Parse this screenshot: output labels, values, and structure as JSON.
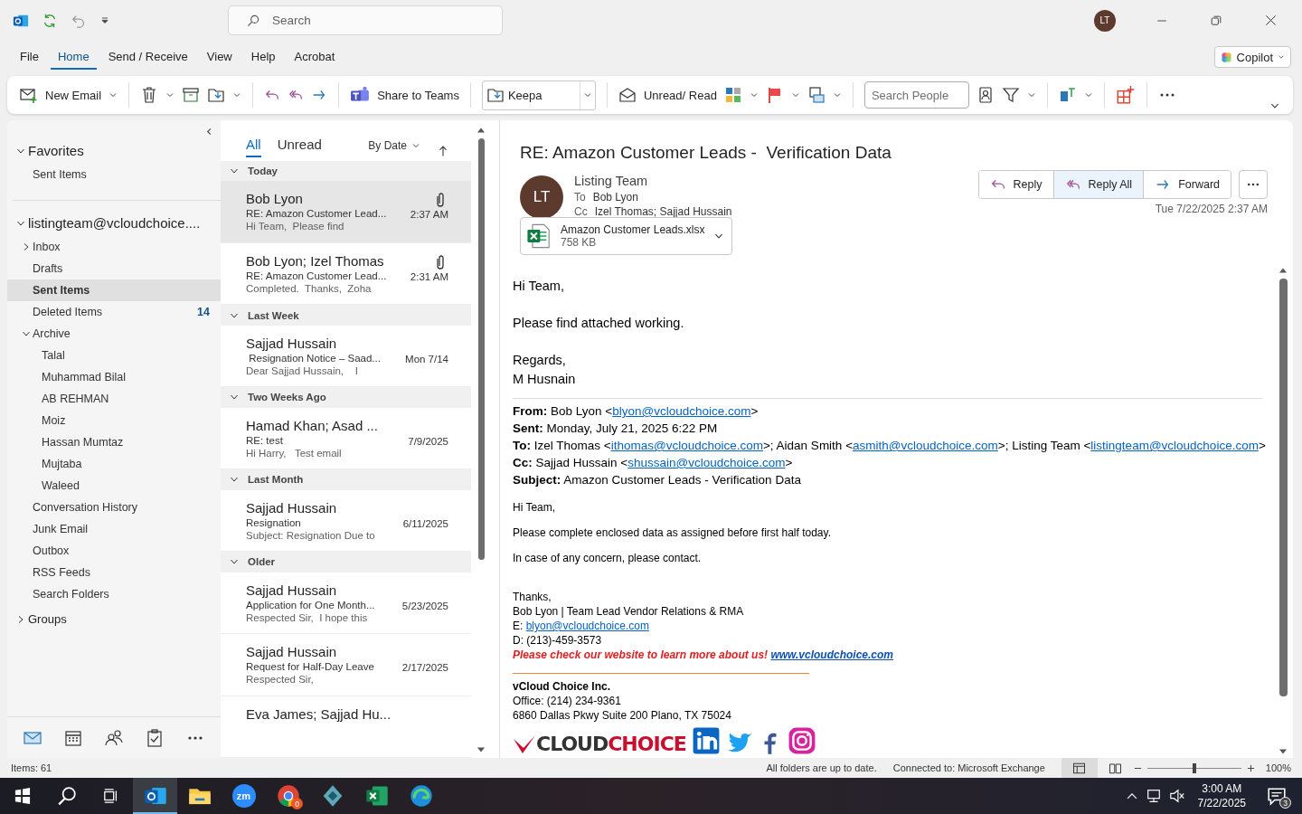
{
  "title_bar": {
    "search": {
      "placeholder": "Search"
    },
    "avatar": "LT"
  },
  "menu": [
    {
      "label": "File",
      "selected": false
    },
    {
      "label": "Home",
      "selected": true
    },
    {
      "label": "Send / Receive",
      "selected": false
    },
    {
      "label": "View",
      "selected": false
    },
    {
      "label": "Help",
      "selected": false
    },
    {
      "label": "Acrobat",
      "selected": false
    }
  ],
  "copilot": "Copilot",
  "ribbon": {
    "new_email": "New Email",
    "share_to_teams": "Share to Teams",
    "move_to": "Keepa",
    "unread_read": "Unread/ Read",
    "search_people": {
      "placeholder": "Search People"
    }
  },
  "folders": [
    {
      "label": "Favorites",
      "kind": "section",
      "expanded": true,
      "children": [
        {
          "label": "Sent Items",
          "selected": false
        }
      ]
    },
    {
      "label": "listingteam@vcloudchoice....",
      "kind": "section",
      "expanded": true,
      "children": [
        {
          "label": "Inbox",
          "selected": false,
          "expanded": false
        },
        {
          "label": "Drafts",
          "selected": false
        },
        {
          "label": "Sent Items",
          "selected": true
        },
        {
          "label": "Deleted Items",
          "selected": false,
          "count": "14"
        },
        {
          "label": "Archive",
          "selected": false,
          "expanded": true,
          "children": [
            {
              "label": "Talal",
              "selected": false
            },
            {
              "label": "Muhammad Bilal",
              "selected": false
            },
            {
              "label": "AB REHMAN",
              "selected": false
            },
            {
              "label": "Moiz",
              "selected": false
            },
            {
              "label": "Hassan Mumtaz",
              "selected": false
            },
            {
              "label": "Mujtaba",
              "selected": false
            },
            {
              "label": "Waleed",
              "selected": false
            }
          ]
        },
        {
          "label": "Conversation History",
          "selected": false
        },
        {
          "label": "Junk Email",
          "selected": false
        },
        {
          "label": "Outbox",
          "selected": false
        },
        {
          "label": "RSS Feeds",
          "selected": false
        },
        {
          "label": "Search Folders",
          "selected": false
        }
      ]
    },
    {
      "label": "Groups",
      "kind": "group",
      "expanded": false
    }
  ],
  "message_list": {
    "tabs": [
      {
        "label": "All",
        "selected": true
      },
      {
        "label": "Unread",
        "selected": false
      }
    ],
    "sort": "By Date",
    "groups": [
      {
        "label": "Today",
        "expanded": true,
        "messages": [
          {
            "sender": "Bob Lyon",
            "subject": "RE: Amazon Customer Lead...",
            "preview": "Hi Team,  Please find",
            "time": "2:37 AM",
            "attachment": true,
            "selected": true
          },
          {
            "sender": "Bob Lyon; Izel Thomas",
            "subject": "RE: Amazon Customer Lead...",
            "preview": "Completed.  Thanks,  Zoha",
            "time": "2:31 AM",
            "attachment": true,
            "selected": false
          }
        ]
      },
      {
        "label": "Last Week",
        "expanded": true,
        "messages": [
          {
            "sender": "Sajjad Hussain",
            "subject": " Resignation Notice – Saad...",
            "preview": "Dear Sajjad Hussain,    I",
            "time": "Mon 7/14",
            "attachment": false,
            "selected": false
          }
        ]
      },
      {
        "label": "Two Weeks Ago",
        "expanded": true,
        "messages": [
          {
            "sender": "Hamad Khan; Asad ...",
            "subject": "RE: test",
            "preview": "Hi Harry,   Test email",
            "time": "7/9/2025",
            "attachment": false,
            "selected": false
          }
        ]
      },
      {
        "label": "Last Month",
        "expanded": true,
        "messages": [
          {
            "sender": "Sajjad Hussain",
            "subject": "Resignation",
            "preview": "Subject: Resignation Due to",
            "time": "6/11/2025",
            "attachment": false,
            "selected": false
          }
        ]
      },
      {
        "label": "Older",
        "expanded": true,
        "messages": [
          {
            "sender": "Sajjad Hussain",
            "subject": "Application for One Month...",
            "preview": "Respected Sir,  I hope this",
            "time": "5/23/2025",
            "attachment": false,
            "selected": false
          },
          {
            "sender": "Sajjad Hussain",
            "subject": "Request for Half-Day Leave",
            "preview": "Respected Sir,",
            "time": "2/17/2025",
            "attachment": false,
            "selected": false
          },
          {
            "sender": "Eva James; Sajjad Hu...",
            "attachment": false,
            "selected": false
          }
        ]
      }
    ]
  },
  "reading_pane": {
    "subject": "RE: Amazon Customer Leads -  Verification Data",
    "sender": {
      "initials": "LT",
      "name": "Listing Team",
      "to_label": "To",
      "to": "Bob Lyon",
      "cc_label": "Cc",
      "cc": "Izel Thomas; Sajjad Hussain"
    },
    "actions": [
      {
        "kind": "reply",
        "label": "Reply",
        "selected": false
      },
      {
        "kind": "reply_all",
        "label": "Reply All",
        "selected": true
      },
      {
        "kind": "forward",
        "label": "Forward",
        "selected": false
      }
    ],
    "date": "Tue 7/22/2025 2:37 AM",
    "attachment": {
      "name": "Amazon Customer Leads.xlsx",
      "size": "758 KB"
    },
    "body": [
      [
        "Hi Team,"
      ],
      [
        "Please find attached working."
      ],
      [
        "Regards,",
        "M Husnain"
      ]
    ],
    "quoted_header": [
      {
        "label": "From:",
        "parts": [
          {
            "kind": "text",
            "text": " Bob Lyon <"
          },
          {
            "kind": "link",
            "text": "blyon@vcloudchoice.com"
          },
          {
            "kind": "text",
            "text": ">"
          }
        ]
      },
      {
        "label": "Sent:",
        "parts": [
          {
            "kind": "text",
            "text": " Monday, July 21, 2025 6:22 PM"
          }
        ]
      },
      {
        "label": "To:",
        "parts": [
          {
            "kind": "text",
            "text": " Izel Thomas <"
          },
          {
            "kind": "link",
            "text": "ithomas@vcloudchoice.com"
          },
          {
            "kind": "text",
            "text": ">; Aidan Smith <"
          },
          {
            "kind": "link",
            "text": "asmith@vcloudchoice.com"
          },
          {
            "kind": "text",
            "text": ">; Listing Team <"
          },
          {
            "kind": "link",
            "text": "listingteam@vcloudchoice.com"
          },
          {
            "kind": "text",
            "text": ">"
          }
        ]
      },
      {
        "label": "Cc:",
        "parts": [
          {
            "kind": "text",
            "text": " Sajjad Hussain <"
          },
          {
            "kind": "link",
            "text": "shussain@vcloudchoice.com"
          },
          {
            "kind": "text",
            "text": ">"
          }
        ]
      },
      {
        "label": "Subject:",
        "parts": [
          {
            "kind": "text",
            "text": " Amazon Customer Leads - Verification Data"
          }
        ]
      }
    ],
    "quoted_body": [
      "Hi Team,",
      "Please complete enclosed data as assigned before first half today.",
      "In case of any concern, please contact."
    ],
    "signature": {
      "closing": "Thanks,",
      "title": "Bob Lyon | Team Lead Vendor Relations & RMA",
      "email_label": "E: ",
      "email": "blyon@vcloudchoice.com",
      "direct": "D: (213)-459-3573",
      "promo": "Please check our website to learn more about us! ",
      "website": "www.vcloudchoice.com",
      "company": "vCloud Choice Inc.",
      "office": "Office: (214) 234-9361",
      "address": "6860 Dallas Pkwy Suite 200 Plano, TX 75024",
      "logo": {
        "dark": "CLOUD",
        "red": "CHOICE"
      }
    }
  },
  "status_bar": {
    "items": "Items: 61",
    "sync": "All folders are up to date.",
    "connection": "Connected to: Microsoft Exchange",
    "zoom": "100%",
    "zoom_level": {
      "level": 0.5
    }
  },
  "taskbar": {
    "apps": [
      {
        "kind": "outlook",
        "active": true
      },
      {
        "kind": "files",
        "active": false
      },
      {
        "kind": "zoom",
        "label": "zm",
        "active": false
      },
      {
        "kind": "chrome",
        "badge": "0",
        "active": false
      },
      {
        "kind": "app",
        "active": false
      },
      {
        "kind": "excel",
        "active": false
      },
      {
        "kind": "edge",
        "active": false
      }
    ],
    "time": "3:00 AM",
    "date": "7/22/2025",
    "notifications": "3"
  }
}
